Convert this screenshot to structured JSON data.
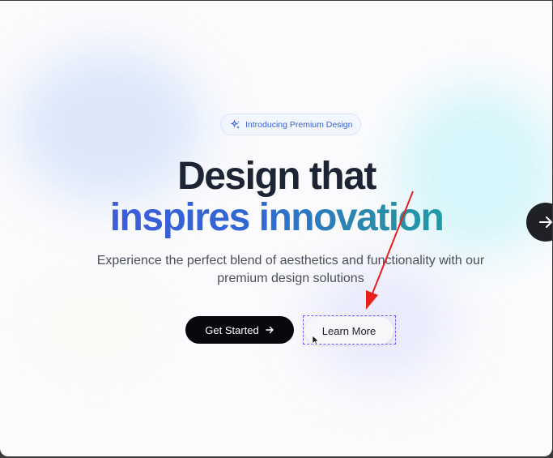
{
  "hero": {
    "badge": {
      "icon": "sparkle-icon",
      "label": "Introducing Premium Design"
    },
    "headline_line1": "Design that",
    "headline_line2": "inspires innovation",
    "subtitle": "Experience the perfect blend of aesthetics and functionality with our premium design solutions",
    "primary_button": {
      "label": "Get Started",
      "icon": "arrow-right-icon"
    },
    "secondary_button": {
      "label": "Learn More"
    }
  },
  "carousel": {
    "next_icon": "arrow-right-icon"
  },
  "colors": {
    "headline_dark": "#1d2433",
    "gradient_start": "#3d5bd8",
    "gradient_end": "#1f9aa7",
    "primary_button_bg": "#07080b",
    "badge_text": "#3a63d1",
    "annotation_arrow": "#e8201c",
    "selection_outline": "#7a5cff"
  }
}
